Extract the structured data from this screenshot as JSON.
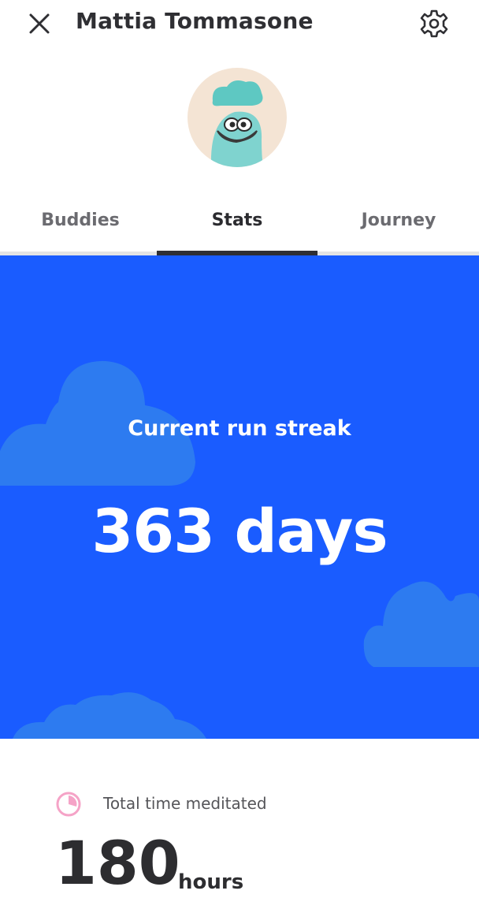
{
  "header": {
    "title": "Mattia Tommasone"
  },
  "icons": {
    "close": "close-icon",
    "settings": "gear-icon",
    "avatar": "blob-character-avatar",
    "time": "pie-timer-icon"
  },
  "tabs": [
    {
      "label": "Buddies",
      "active": false
    },
    {
      "label": "Stats",
      "active": true
    },
    {
      "label": "Journey",
      "active": false
    }
  ],
  "streak": {
    "label": "Current run streak",
    "value": "363 days"
  },
  "total_time": {
    "label": "Total time meditated",
    "value": "180",
    "unit": "hours"
  },
  "colors": {
    "streak_background": "#1a5cff",
    "cloud": "#2d7bf0",
    "time_icon": "#f5a3c7",
    "title": "#2f2f33"
  }
}
